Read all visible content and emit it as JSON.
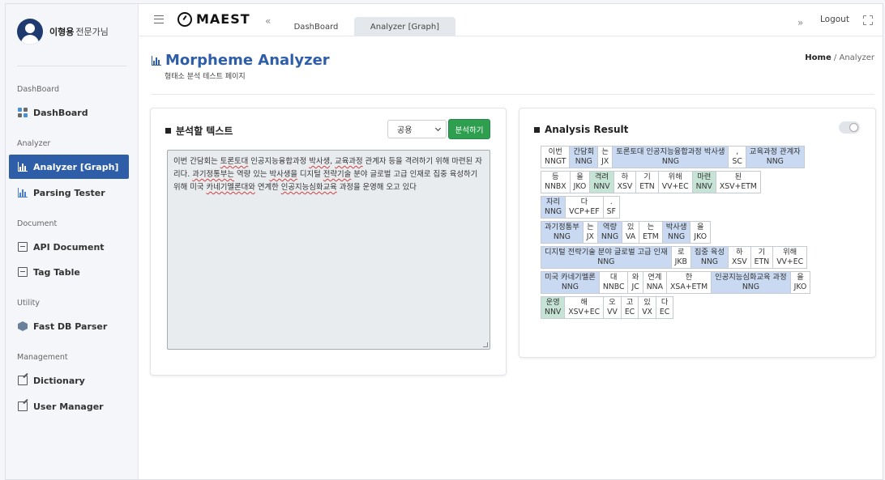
{
  "user": {
    "name": "이형용",
    "role": "전문가님"
  },
  "sidebar": {
    "sections": [
      {
        "title": "DashBoard",
        "items": [
          {
            "label": "DashBoard",
            "icon": "grid-icon",
            "active": false
          }
        ]
      },
      {
        "title": "Analyzer",
        "items": [
          {
            "label": "Analyzer [Graph]",
            "icon": "bar-chart-icon",
            "active": true
          },
          {
            "label": "Parsing Tester",
            "icon": "bar-chart-icon",
            "active": false
          }
        ]
      },
      {
        "title": "Document",
        "items": [
          {
            "label": "API Document",
            "icon": "document-icon",
            "active": false
          },
          {
            "label": "Tag Table",
            "icon": "document-icon",
            "active": false
          }
        ]
      },
      {
        "title": "Utility",
        "items": [
          {
            "label": "Fast DB Parser",
            "icon": "cube-icon",
            "active": false
          }
        ]
      },
      {
        "title": "Management",
        "items": [
          {
            "label": "Dictionary",
            "icon": "edit-icon",
            "active": false
          },
          {
            "label": "User Manager",
            "icon": "edit-icon",
            "active": false
          }
        ]
      }
    ]
  },
  "topbar": {
    "logo": "MAEST",
    "nav_left": "«",
    "tabs": [
      {
        "label": "DashBoard",
        "active": false
      },
      {
        "label": "Analyzer [Graph]",
        "active": true
      }
    ],
    "nav_right": "»",
    "logout": "Logout"
  },
  "page": {
    "title": "Morpheme Analyzer",
    "subtitle": "형태소 분석 테스트 페이지",
    "breadcrumb": {
      "home": "Home",
      "separator": "/",
      "current": "Analyzer"
    }
  },
  "input_card": {
    "heading": "분석할 텍스트",
    "select_value": "공용",
    "analyze_button": "분석하기",
    "text_segments": [
      {
        "t": "이번 간담회는 ",
        "u": false
      },
      {
        "t": "토론토대",
        "u": true
      },
      {
        "t": " 인공지능융합과정 ",
        "u": false
      },
      {
        "t": "박사생",
        "u": true
      },
      {
        "t": ", ",
        "u": false
      },
      {
        "t": "교육과정",
        "u": true
      },
      {
        "t": " 관계자 등을 격려하기 위해 마련된 자리다. ",
        "u": false
      },
      {
        "t": "과기정통부는",
        "u": true
      },
      {
        "t": " 역량 있는 ",
        "u": false
      },
      {
        "t": "박사생을",
        "u": true
      },
      {
        "t": " 디지털 ",
        "u": false
      },
      {
        "t": "전략기술",
        "u": true
      },
      {
        "t": " 분야 글로벌 고급 인재로 집중 육성하기 위해 미국 ",
        "u": false
      },
      {
        "t": "카네기멜론대와",
        "u": true
      },
      {
        "t": " 연계한 ",
        "u": false
      },
      {
        "t": "인공지능심화교육",
        "u": true
      },
      {
        "t": " 과정을 운영해 오고 있다",
        "u": false
      }
    ]
  },
  "result_card": {
    "heading": "Analysis Result",
    "rows": [
      [
        {
          "form": "이번",
          "tag": "NNGT",
          "cls": ""
        },
        {
          "form": "간담회",
          "tag": "NNG",
          "cls": "NNG"
        },
        {
          "form": "는",
          "tag": "JX",
          "cls": ""
        },
        {
          "form": "토론토대 인공지능융합과정 박사생",
          "tag": "NNG",
          "cls": "NNG"
        },
        {
          "form": ",",
          "tag": "SC",
          "cls": ""
        },
        {
          "form": "교육과정 관계자",
          "tag": "NNG",
          "cls": "NNG"
        }
      ],
      [
        {
          "form": "등",
          "tag": "NNBX",
          "cls": ""
        },
        {
          "form": "을",
          "tag": "JKO",
          "cls": ""
        },
        {
          "form": "격려",
          "tag": "NNV",
          "cls": "NNV"
        },
        {
          "form": "하",
          "tag": "XSV",
          "cls": ""
        },
        {
          "form": "기",
          "tag": "ETN",
          "cls": ""
        },
        {
          "form": "위해",
          "tag": "VV+EC",
          "cls": ""
        },
        {
          "form": "마련",
          "tag": "NNV",
          "cls": "NNV"
        },
        {
          "form": "된",
          "tag": "XSV+ETM",
          "cls": ""
        }
      ],
      [
        {
          "form": "자리",
          "tag": "NNG",
          "cls": "NNG"
        },
        {
          "form": "다",
          "tag": "VCP+EF",
          "cls": ""
        },
        {
          "form": ".",
          "tag": "SF",
          "cls": ""
        }
      ],
      [
        {
          "form": "과기정통부",
          "tag": "NNG",
          "cls": "NNG"
        },
        {
          "form": "는",
          "tag": "JX",
          "cls": ""
        },
        {
          "form": "역량",
          "tag": "NNG",
          "cls": "NNG"
        },
        {
          "form": "있",
          "tag": "VA",
          "cls": ""
        },
        {
          "form": "는",
          "tag": "ETM",
          "cls": ""
        },
        {
          "form": "박사생",
          "tag": "NNG",
          "cls": "NNG"
        },
        {
          "form": "을",
          "tag": "JKO",
          "cls": ""
        }
      ],
      [
        {
          "form": "디지털 전략기술 분야 글로벌 고급 인재",
          "tag": "NNG",
          "cls": "NNG"
        },
        {
          "form": "로",
          "tag": "JKB",
          "cls": ""
        },
        {
          "form": "집중 육성",
          "tag": "NNG",
          "cls": "NNG"
        },
        {
          "form": "하",
          "tag": "XSV",
          "cls": ""
        },
        {
          "form": "기",
          "tag": "ETN",
          "cls": ""
        },
        {
          "form": "위해",
          "tag": "VV+EC",
          "cls": ""
        }
      ],
      [
        {
          "form": "미국 카네기멜론",
          "tag": "NNG",
          "cls": "NNG"
        },
        {
          "form": "대",
          "tag": "NNBC",
          "cls": ""
        },
        {
          "form": "와",
          "tag": "JC",
          "cls": ""
        },
        {
          "form": "연계",
          "tag": "NNA",
          "cls": ""
        },
        {
          "form": "한",
          "tag": "XSA+ETM",
          "cls": ""
        },
        {
          "form": "인공지능심화교육 과정",
          "tag": "NNG",
          "cls": "NNG"
        },
        {
          "form": "을",
          "tag": "JKO",
          "cls": ""
        }
      ],
      [
        {
          "form": "운영",
          "tag": "NNV",
          "cls": "NNV"
        },
        {
          "form": "해",
          "tag": "XSV+EC",
          "cls": ""
        },
        {
          "form": "오",
          "tag": "VV",
          "cls": ""
        },
        {
          "form": "고",
          "tag": "EC",
          "cls": ""
        },
        {
          "form": "있",
          "tag": "VX",
          "cls": ""
        },
        {
          "form": "다",
          "tag": "EC",
          "cls": ""
        }
      ]
    ]
  }
}
